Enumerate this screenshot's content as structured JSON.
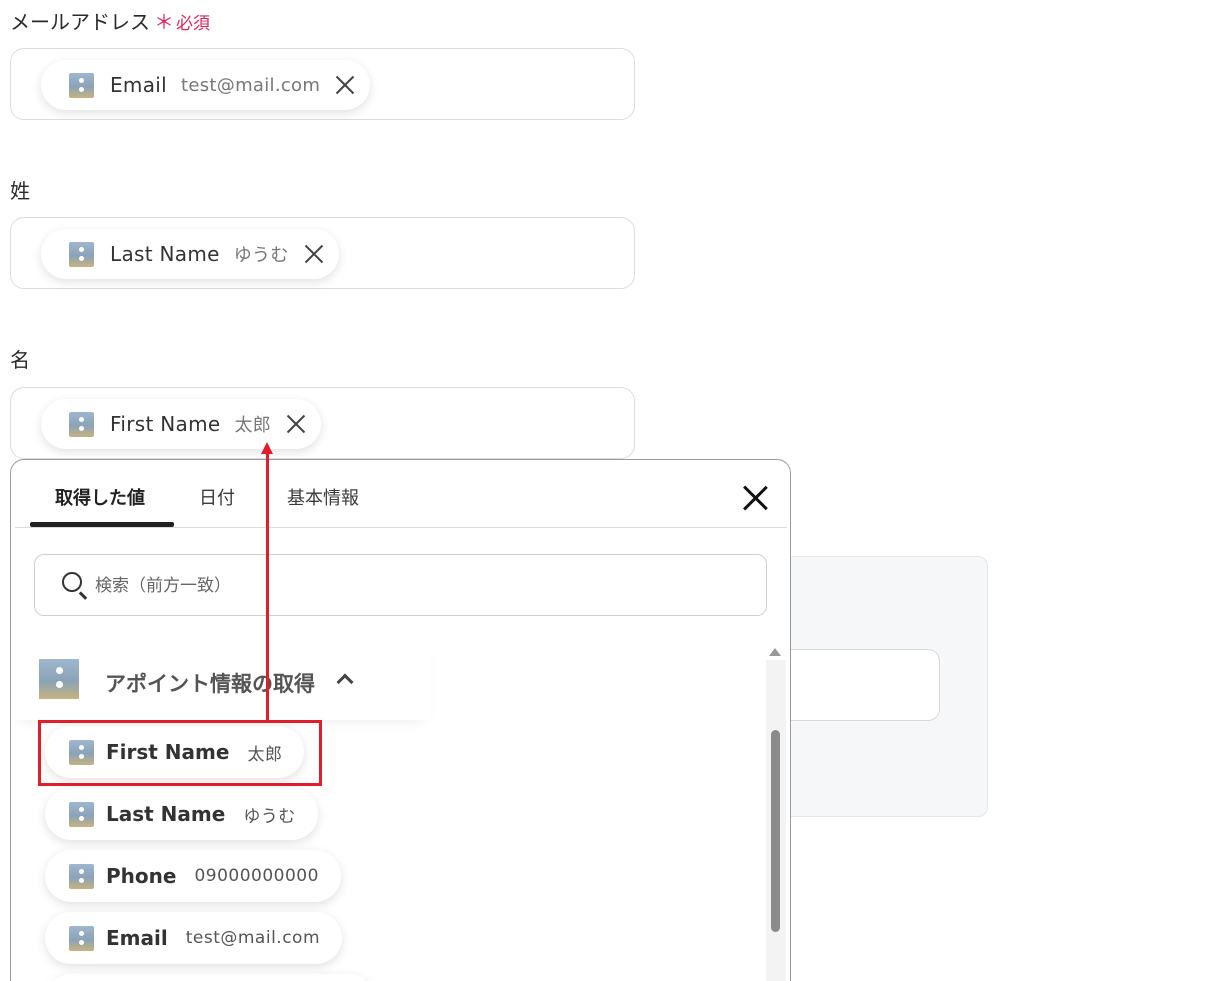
{
  "fields": {
    "email": {
      "label": "メールアドレス",
      "required_mark": "＊",
      "required_text": "必須",
      "chip": {
        "name": "Email",
        "value": "test@mail.com"
      }
    },
    "last_name": {
      "label": "姓",
      "chip": {
        "name": "Last Name",
        "value": "ゆうむ"
      }
    },
    "first_name": {
      "label": "名",
      "chip": {
        "name": "First Name",
        "value": "太郎"
      }
    }
  },
  "popup": {
    "tabs": [
      "取得した値",
      "日付",
      "基本情報"
    ],
    "active_tab": "取得した値",
    "search_placeholder": "検索（前方一致）",
    "group": {
      "title": "アポイント情報の取得",
      "expanded": true,
      "items": [
        {
          "name": "First Name",
          "value": "太郎",
          "highlighted": true
        },
        {
          "name": "Last Name",
          "value": "ゆうむ"
        },
        {
          "name": "Phone",
          "value": "09000000000"
        },
        {
          "name": "Email",
          "value": "test@mail.com"
        }
      ]
    }
  },
  "colors": {
    "required": "#e0245e",
    "highlight": "#e01e2b"
  }
}
